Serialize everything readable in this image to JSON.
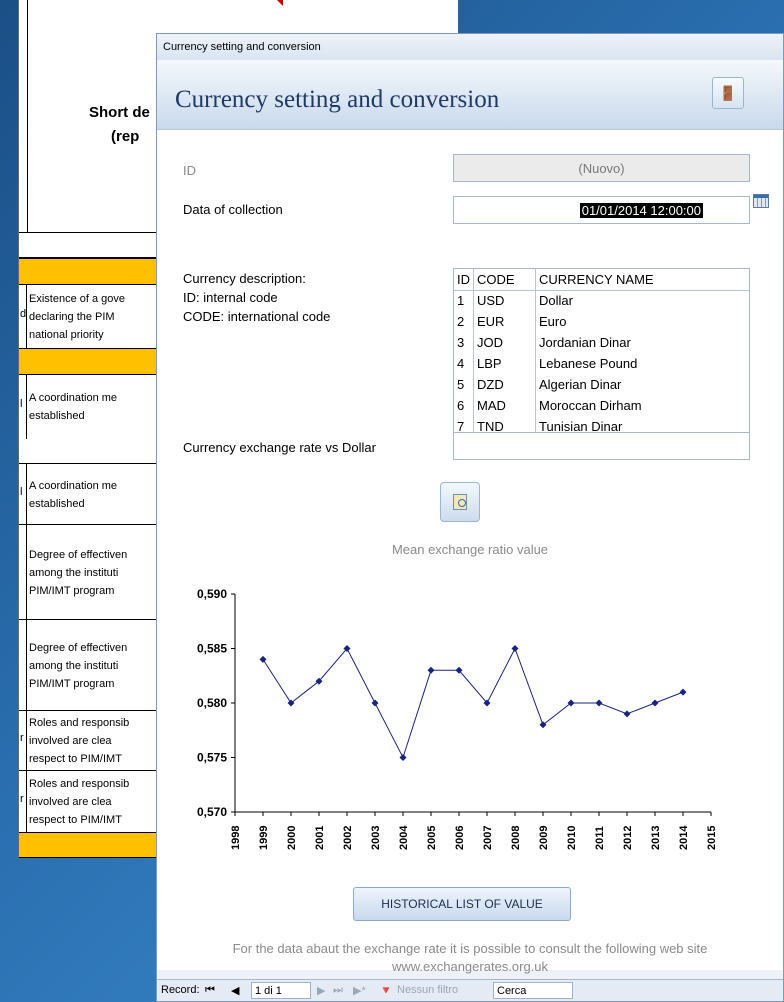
{
  "sheet": {
    "title": "Short de",
    "subtitle": "(rep",
    "rows": [
      {
        "left": "d",
        "lines": [
          "Existence of a gove",
          "declaring the PIM",
          "national priority"
        ]
      },
      {
        "left": "l",
        "lines": [
          "A coordination me",
          "established"
        ]
      },
      {
        "left": "l",
        "lines": [
          "A coordination me",
          "established"
        ]
      },
      {
        "left": "",
        "lines": [
          "Degree of effectiven",
          "among the instituti",
          "PIM/IMT program"
        ]
      },
      {
        "left": "",
        "lines": [
          "Degree of effectiven",
          "among the instituti",
          "PIM/IMT program"
        ]
      },
      {
        "left": "r",
        "lines": [
          "Roles and responsib",
          "involved are clea",
          "respect to PIM/IMT"
        ]
      },
      {
        "left": "r",
        "lines": [
          "Roles and responsib",
          "involved are clea",
          "respect to PIM/IMT"
        ]
      }
    ]
  },
  "dialog": {
    "window_title": "Currency setting and conversion",
    "header_title": "Currency setting and conversion",
    "exit_icon": "exit-door-icon"
  },
  "form": {
    "id_label": "ID",
    "id_value": "(Nuovo)",
    "date_label": "Data of collection",
    "date_value": "01/01/2014 12:00:00",
    "currency_desc_label": "Currency description:",
    "currency_id_label": "ID: internal code",
    "currency_code_label": "CODE: international code",
    "rate_label": "Currency exchange rate vs Dollar",
    "rate_value": ""
  },
  "currency_table": {
    "headers": [
      "ID",
      "CODE",
      "CURRENCY NAME"
    ],
    "rows": [
      [
        "1",
        "USD",
        "Dollar"
      ],
      [
        "2",
        "EUR",
        "Euro"
      ],
      [
        "3",
        "JOD",
        "Jordanian Dinar"
      ],
      [
        "4",
        "LBP",
        "Lebanese Pound"
      ],
      [
        "5",
        "DZD",
        "Algerian Dinar"
      ],
      [
        "6",
        "MAD",
        "Moroccan Dirham"
      ],
      [
        "7",
        "TND",
        "Tunisian Dinar"
      ]
    ]
  },
  "chart_caption": "Mean exchange ratio value",
  "chart_data": {
    "type": "line",
    "title": "Mean exchange ratio value",
    "x": [
      1999,
      2000,
      2001,
      2002,
      2003,
      2004,
      2005,
      2006,
      2007,
      2008,
      2009,
      2010,
      2011,
      2012,
      2013,
      2014
    ],
    "values": [
      0.584,
      0.58,
      0.582,
      0.585,
      0.58,
      0.575,
      0.583,
      0.583,
      0.58,
      0.585,
      0.578,
      0.58,
      0.58,
      0.579,
      0.58,
      0.581
    ],
    "x_ticks": [
      "1998",
      "1999",
      "2000",
      "2001",
      "2002",
      "2003",
      "2004",
      "2005",
      "2006",
      "2007",
      "2008",
      "2009",
      "2010",
      "2011",
      "2012",
      "2013",
      "2014",
      "2015"
    ],
    "y_ticks": [
      "0,590",
      "0,585",
      "0,580",
      "0,575",
      "0,570"
    ],
    "xlim": [
      1998,
      2015
    ],
    "ylim": [
      0.57,
      0.59
    ],
    "grid": false,
    "color": "#1a237e"
  },
  "historical_button": "HISTORICAL LIST OF VALUE",
  "footnote_line1": "For the data abaut the exchange rate it is possible to consult the following web site",
  "footnote_line2": "www.exchangerates.org.uk",
  "statusbar": {
    "record_label": "Record:",
    "first": "⏮",
    "prev": "◀",
    "record_value": "1 di 1",
    "next": "▶",
    "last": "⏭",
    "new": "▶*",
    "filter_label": "Nessun filtro",
    "search_label": "Cerca"
  }
}
